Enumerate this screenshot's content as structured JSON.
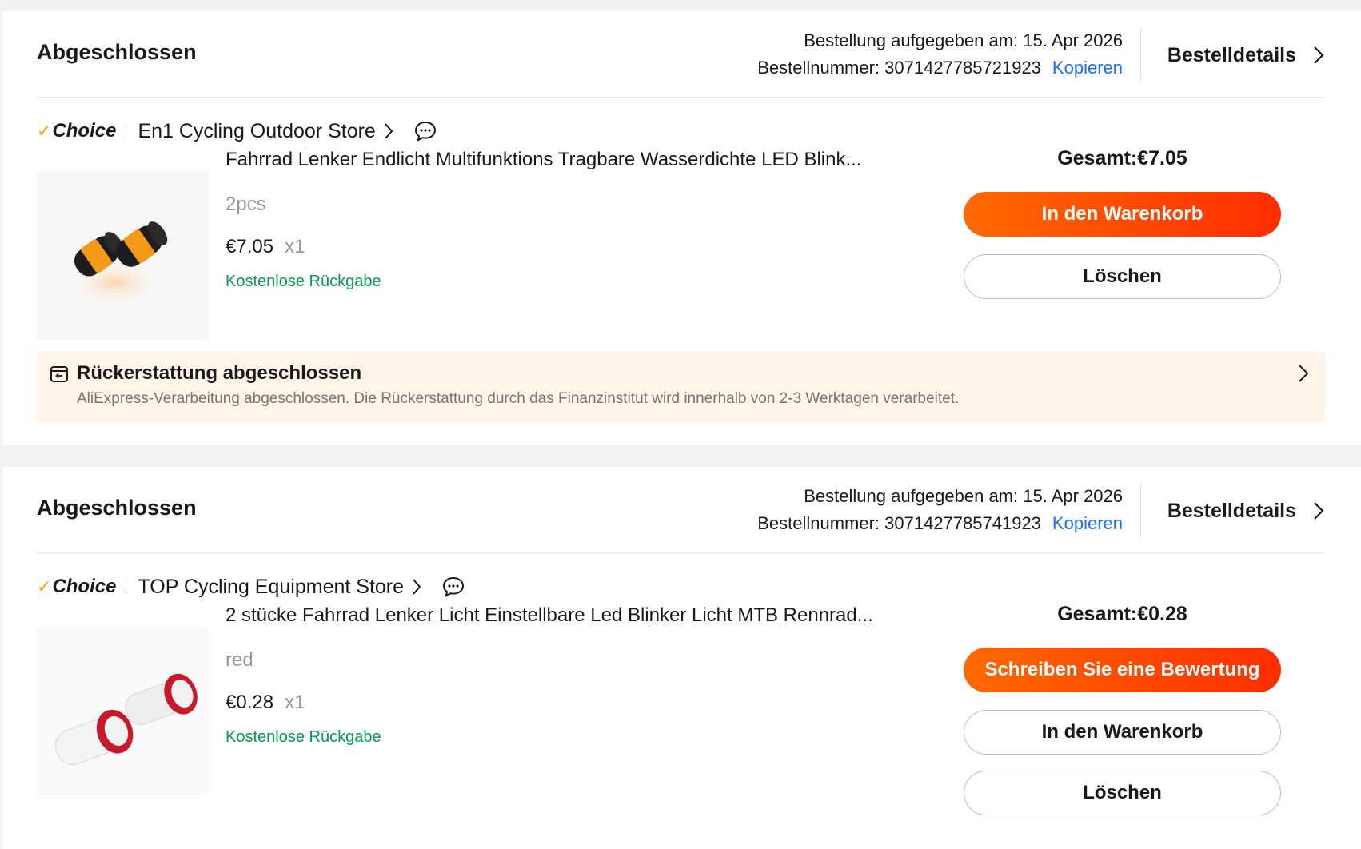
{
  "orders": [
    {
      "status": "Abgeschlossen",
      "order_date": "Bestellung aufgegeben am: 15. Apr 2026",
      "order_number": "Bestellnummer: 3071427785721923",
      "copy_label": "Kopieren",
      "details_label": "Bestelldetails",
      "choice_label": "Choice",
      "store_name": "En1 Cycling Outdoor Store",
      "product_title": "Fahrrad Lenker Endlicht Multifunktions Tragbare Wasserdichte LED Blink...",
      "variant": "2pcs",
      "price": "€7.05",
      "quantity": "x1",
      "free_return": "Kostenlose Rückgabe",
      "total": "Gesamt:€7.05",
      "buttons": [
        "In den Warenkorb",
        "Löschen"
      ],
      "refund": {
        "title": "Rückerstattung abgeschlossen",
        "description": "AliExpress-Verarbeitung abgeschlossen. Die Rückerstattung durch das Finanzinstitut wird innerhalb von 2-3 Werktagen verarbeitet."
      }
    },
    {
      "status": "Abgeschlossen",
      "order_date": "Bestellung aufgegeben am: 15. Apr 2026",
      "order_number": "Bestellnummer: 3071427785741923",
      "copy_label": "Kopieren",
      "details_label": "Bestelldetails",
      "choice_label": "Choice",
      "store_name": "TOP Cycling Equipment Store",
      "product_title": "2 stücke Fahrrad Lenker Licht Einstellbare Led Blinker Licht MTB Rennrad...",
      "variant": "red",
      "price": "€0.28",
      "quantity": "x1",
      "free_return": "Kostenlose Rückgabe",
      "total": "Gesamt:€0.28",
      "buttons": [
        "Schreiben Sie eine Bewertung",
        "In den Warenkorb",
        "Löschen"
      ]
    }
  ],
  "colors": {
    "accent_orange": "#fe4f00",
    "link_blue": "#1a6dff",
    "free_return_green": "#00a04a",
    "refund_background": "#fff4e8",
    "choice_check": "#fda400"
  },
  "icons": [
    "chevron-right-icon",
    "chat-bubble-icon",
    "refund-icon",
    "choice-check-icon"
  ]
}
